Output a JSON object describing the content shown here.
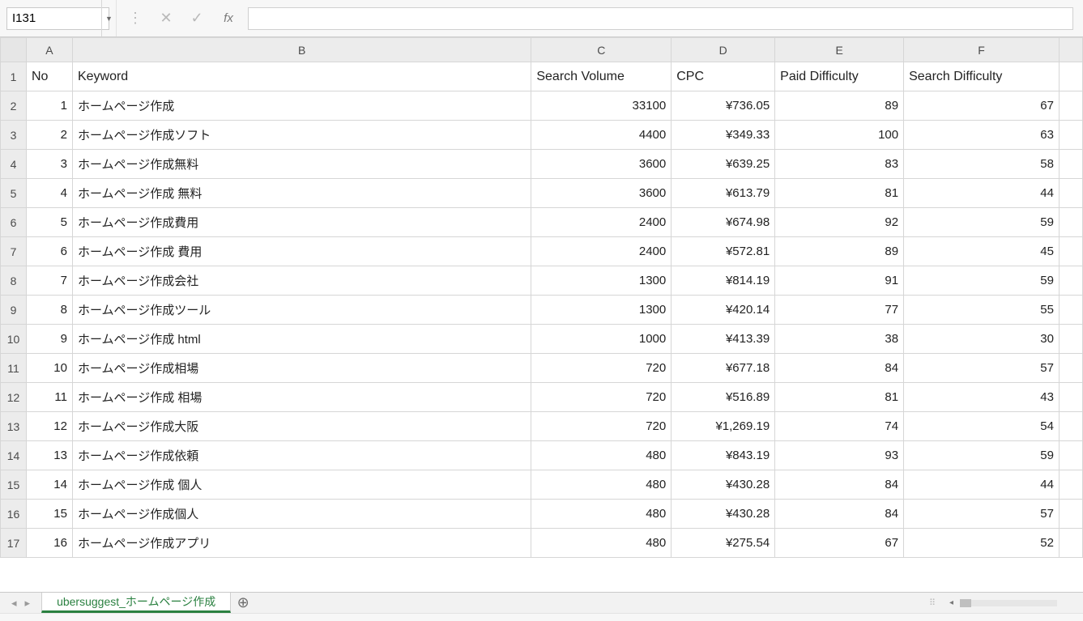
{
  "nameBox": {
    "value": "I131"
  },
  "formula": {
    "value": ""
  },
  "fx_label": "fx",
  "icons": {
    "cancel": "✕",
    "confirm": "✓",
    "dropdown": "▼",
    "vsep": "⋮",
    "nav_first": "◂",
    "nav_prev": "▸",
    "add": "⊕",
    "drag": "⠿"
  },
  "columns": [
    "A",
    "B",
    "C",
    "D",
    "E",
    "F"
  ],
  "headers": {
    "A": "No",
    "B": "Keyword",
    "C": "Search Volume",
    "D": "CPC",
    "E": "Paid Difficulty",
    "F": "Search Difficulty"
  },
  "rows": [
    {
      "no": 1,
      "keyword": "ホームページ作成",
      "volume": "33100",
      "cpc": "¥736.05",
      "paid": "89",
      "search": "67"
    },
    {
      "no": 2,
      "keyword": "ホームページ作成ソフト",
      "volume": "4400",
      "cpc": "¥349.33",
      "paid": "100",
      "search": "63"
    },
    {
      "no": 3,
      "keyword": "ホームページ作成無料",
      "volume": "3600",
      "cpc": "¥639.25",
      "paid": "83",
      "search": "58"
    },
    {
      "no": 4,
      "keyword": "ホームページ作成 無料",
      "volume": "3600",
      "cpc": "¥613.79",
      "paid": "81",
      "search": "44"
    },
    {
      "no": 5,
      "keyword": "ホームページ作成費用",
      "volume": "2400",
      "cpc": "¥674.98",
      "paid": "92",
      "search": "59"
    },
    {
      "no": 6,
      "keyword": "ホームページ作成 費用",
      "volume": "2400",
      "cpc": "¥572.81",
      "paid": "89",
      "search": "45"
    },
    {
      "no": 7,
      "keyword": "ホームページ作成会社",
      "volume": "1300",
      "cpc": "¥814.19",
      "paid": "91",
      "search": "59"
    },
    {
      "no": 8,
      "keyword": "ホームページ作成ツール",
      "volume": "1300",
      "cpc": "¥420.14",
      "paid": "77",
      "search": "55"
    },
    {
      "no": 9,
      "keyword": "ホームページ作成 html",
      "volume": "1000",
      "cpc": "¥413.39",
      "paid": "38",
      "search": "30"
    },
    {
      "no": 10,
      "keyword": "ホームページ作成相場",
      "volume": "720",
      "cpc": "¥677.18",
      "paid": "84",
      "search": "57"
    },
    {
      "no": 11,
      "keyword": "ホームページ作成 相場",
      "volume": "720",
      "cpc": "¥516.89",
      "paid": "81",
      "search": "43"
    },
    {
      "no": 12,
      "keyword": "ホームページ作成大阪",
      "volume": "720",
      "cpc": "¥1,269.19",
      "paid": "74",
      "search": "54"
    },
    {
      "no": 13,
      "keyword": "ホームページ作成依頼",
      "volume": "480",
      "cpc": "¥843.19",
      "paid": "93",
      "search": "59"
    },
    {
      "no": 14,
      "keyword": "ホームページ作成 個人",
      "volume": "480",
      "cpc": "¥430.28",
      "paid": "84",
      "search": "44"
    },
    {
      "no": 15,
      "keyword": "ホームページ作成個人",
      "volume": "480",
      "cpc": "¥430.28",
      "paid": "84",
      "search": "57"
    },
    {
      "no": 16,
      "keyword": "ホームページ作成アプリ",
      "volume": "480",
      "cpc": "¥275.54",
      "paid": "67",
      "search": "52"
    }
  ],
  "sheetTab": {
    "name": "ubersuggest_ホームページ作成"
  }
}
